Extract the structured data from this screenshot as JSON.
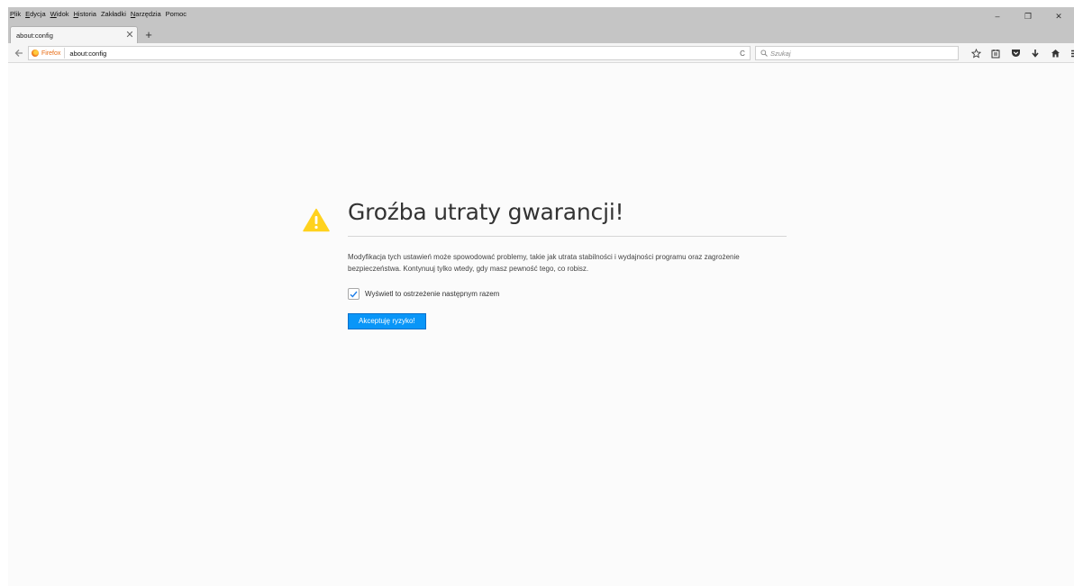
{
  "menubar": {
    "items": [
      {
        "accel": "P",
        "rest": "lik"
      },
      {
        "accel": "E",
        "rest": "dycja"
      },
      {
        "accel": "W",
        "rest": "idok"
      },
      {
        "accel": "H",
        "rest": "istoria"
      },
      {
        "accel": "",
        "rest": "Zakładki"
      },
      {
        "accel": "N",
        "rest": "arzędzia"
      },
      {
        "accel": "",
        "rest": "Pomoc"
      }
    ]
  },
  "window_controls": {
    "minimize": "–",
    "restore": "❐",
    "close": "✕"
  },
  "tabs": [
    {
      "label": "about:config",
      "close": "✕"
    }
  ],
  "new_tab_label": "+",
  "navbar": {
    "identity_label": "Firefox",
    "url": "about:config",
    "reload": "C",
    "search_placeholder": "Szukaj"
  },
  "toolbar_icons": [
    "star-icon",
    "reading-list-icon",
    "pocket-icon",
    "download-icon",
    "home-icon",
    "menu-icon"
  ],
  "warning": {
    "title": "Groźba utraty gwarancji!",
    "text": "Modyfikacja tych ustawień może spowodować problemy, takie jak utrata stabilności i wydajności programu oraz zagrożenie bezpieczeństwa. Kontynuuj tylko wtedy, gdy masz pewność tego, co robisz.",
    "checkbox_label": "Wyświetl to ostrzeżenie następnym razem",
    "checkbox_checked": true,
    "accept_button": "Akceptuję ryzyko!"
  },
  "colors": {
    "accent": "#0996f8",
    "warning": "#ffd21e",
    "identity": "#e86a10"
  }
}
